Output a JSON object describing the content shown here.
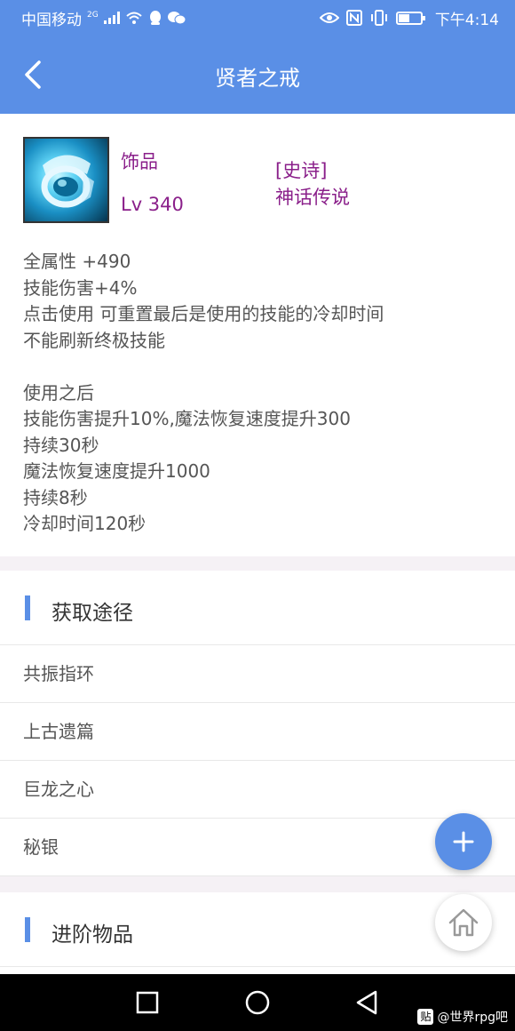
{
  "status_bar": {
    "carrier": "中国移动",
    "network_type": "2G",
    "time": "下午4:14",
    "icons": [
      "signal-icon",
      "wifi-icon",
      "qq-icon",
      "wechat-icon",
      "eye-icon",
      "nfc-icon",
      "vibrate-icon",
      "battery-icon"
    ]
  },
  "nav": {
    "title": "贤者之戒"
  },
  "item": {
    "category": "饰品",
    "level": "Lv 340",
    "rarity": "[史诗]",
    "series": "神话传说",
    "description": [
      "全属性 +490",
      "技能伤害+4%",
      "点击使用 可重置最后是使用的技能的冷却时间",
      "不能刷新终极技能",
      "",
      "使用之后",
      "技能伤害提升10%,魔法恢复速度提升300",
      "持续30秒",
      "魔法恢复速度提升1000",
      "持续8秒",
      "冷却时间120秒"
    ]
  },
  "acquire": {
    "title": "获取途径",
    "items": [
      "共振指环",
      "上古遗篇",
      "巨龙之心",
      "秘银"
    ]
  },
  "advanced": {
    "title": "进阶物品"
  },
  "watermark": {
    "logo": "贴",
    "text": "@世界rpg吧"
  },
  "colors": {
    "primary": "#5a8fe6",
    "rarity_purple": "#8a1f8a"
  }
}
